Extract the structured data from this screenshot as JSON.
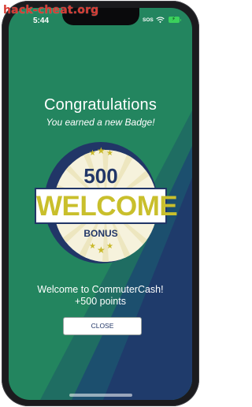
{
  "watermark": "hack-cheat.org",
  "status_bar": {
    "time": "5:44",
    "sos": "SOS"
  },
  "dialog": {
    "title": "Congratulations",
    "subtitle": "You earned a new Badge!",
    "badge": {
      "top": "500",
      "main": "WELCOME",
      "bottom": "BONUS"
    },
    "message_line1": "Welcome to CommuterCash!",
    "message_line2": "+500 points",
    "close_label": "CLOSE"
  },
  "colors": {
    "background_green": "#23855f",
    "background_navy": "#1f3b6b",
    "badge_navy": "#213667",
    "badge_gold": "#c9bf2c",
    "watermark": "#d83a32"
  },
  "icons": [
    "wifi-icon",
    "battery-icon",
    "star-icon"
  ]
}
